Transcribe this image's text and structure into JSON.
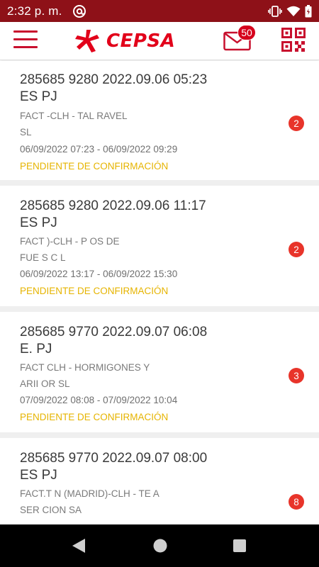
{
  "status_bar": {
    "time": "2:32 p. m.",
    "icons": [
      "at-sign-icon",
      "vibrate-icon",
      "wifi-icon",
      "battery-icon"
    ]
  },
  "app_bar": {
    "logo_text": "CEPSA",
    "mail_badge": "50",
    "icons": [
      "hamburger-menu-icon",
      "cepsa-logo-icon",
      "mail-icon",
      "qr-code-icon"
    ]
  },
  "colors": {
    "status_bar": "#8e1118",
    "brand_red": "#e2001a",
    "pending_yellow": "#e6b400",
    "badge_red": "#e8342a"
  },
  "cards": [
    {
      "title": "285685 9280 2022.09.06 05:23",
      "subtitle": "ES        PJ",
      "line1": "FACT                              -CLH - TAL           RAVEL",
      "line2": "SL",
      "dates": "06/09/2022 07:23 - 06/09/2022 09:29",
      "status": "PENDIENTE DE CONFIRMACIÓN",
      "count": "2"
    },
    {
      "title": "285685 9280 2022.09.06 11:17",
      "subtitle": "ES        PJ",
      "line1": "FACT                             )-CLH - P              OS DE",
      "line2": "FUE           S C L",
      "dates": "06/09/2022 13:17 - 06/09/2022 15:30",
      "status": "PENDIENTE DE CONFIRMACIÓN",
      "count": "2"
    },
    {
      "title": "285685 9770 2022.09.07 06:08",
      "subtitle": "E.        PJ",
      "line1": "FACT                              CLH - HORMIGONES Y",
      "line2": "ARII                    OR SL",
      "dates": "07/09/2022 08:08 - 07/09/2022 10:04",
      "status": "PENDIENTE DE CONFIRMACIÓN",
      "count": "3"
    },
    {
      "title": "285685 9770 2022.09.07 08:00",
      "subtitle": "ES        PJ",
      "line1": "FACT.T         N (MADRID)-CLH - TE               A",
      "line2": "SER                                          CION SA",
      "dates": "",
      "status": "",
      "count": "8"
    }
  ],
  "nav_bar": {
    "icons": [
      "back-triangle-icon",
      "home-circle-icon",
      "recents-square-icon"
    ]
  }
}
